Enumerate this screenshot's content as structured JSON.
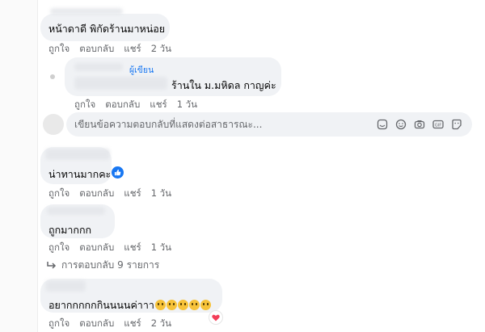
{
  "comments": [
    {
      "text": "หน้าดาดี พิกัดร้านมาหน่อย",
      "like": "ถูกใจ",
      "reply": "ตอบกลับ",
      "share": "แชร์",
      "time": "2 วัน"
    },
    {
      "badge": "ผู้เขียน",
      "text": "ร้านใน ม.มหิดล กาญค่ะ",
      "like": "ถูกใจ",
      "reply": "ตอบกลับ",
      "share": "แชร์",
      "time": "1 วัน"
    },
    {
      "text": "น่าทานมากคะ",
      "like": "ถูกใจ",
      "reply": "ตอบกลับ",
      "share": "แชร์",
      "time": "1 วัน"
    },
    {
      "text": "ถูกมากกก",
      "like": "ถูกใจ",
      "reply": "ตอบกลับ",
      "share": "แชร์",
      "time": "1 วัน"
    },
    {
      "text": "อยากกกกกกินนนนค่าาา",
      "like": "ถูกใจ",
      "reply": "ตอบกลับ",
      "share": "แชร์",
      "time": "2 วัน"
    }
  ],
  "reply_input": {
    "placeholder": "เขียนข้อความตอบกลับที่แสดงต่อสาธารณะ..."
  },
  "replies_link": "การตอบกลับ 9 รายการ",
  "icons": [
    "sticker-icon",
    "emoji-icon",
    "camera-icon",
    "gif-icon",
    "sticker-smile-icon",
    "like-icon",
    "heart-icon"
  ],
  "colors": {
    "link_blue": "#1877f2",
    "bubble": "#f0f2f5",
    "meta": "#65676b",
    "heart": "#f33e58"
  }
}
